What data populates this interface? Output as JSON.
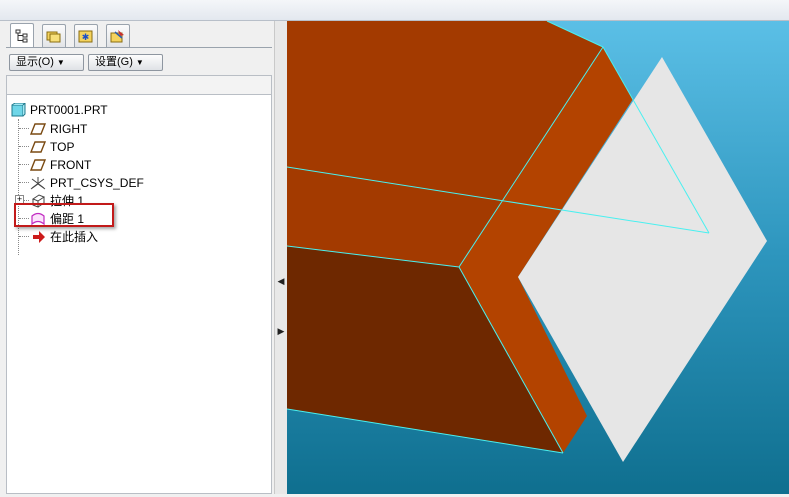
{
  "toolbar": {
    "show_label": "显示(O)",
    "settings_label": "设置(G)"
  },
  "tabs": [
    {
      "icon": "model-tree-icon",
      "active": true
    },
    {
      "icon": "folder-browser-icon",
      "active": false
    },
    {
      "icon": "favorites-icon",
      "active": false
    },
    {
      "icon": "connections-icon",
      "active": false
    }
  ],
  "tree": {
    "root": "PRT0001.PRT",
    "items": [
      {
        "label": "RIGHT",
        "icon": "datum-plane-icon"
      },
      {
        "label": "TOP",
        "icon": "datum-plane-icon"
      },
      {
        "label": "FRONT",
        "icon": "datum-plane-icon"
      },
      {
        "label": "PRT_CSYS_DEF",
        "icon": "csys-icon"
      },
      {
        "label": "拉伸 1",
        "icon": "extrude-icon"
      },
      {
        "label": "偏距 1",
        "icon": "offset-icon"
      },
      {
        "label": "在此插入",
        "icon": "insert-here-arrow-icon"
      }
    ]
  },
  "colors": {
    "viewport_bg_top": "#5bbfe6",
    "viewport_bg_bottom": "#0f6f8f",
    "solid_top": "#a33a00",
    "solid_side": "#6e2800",
    "solid_edge": "#b34300",
    "edge_line": "#49f0f0",
    "offset_plane": "#e6e6e6",
    "highlight": "#c21a1a"
  }
}
